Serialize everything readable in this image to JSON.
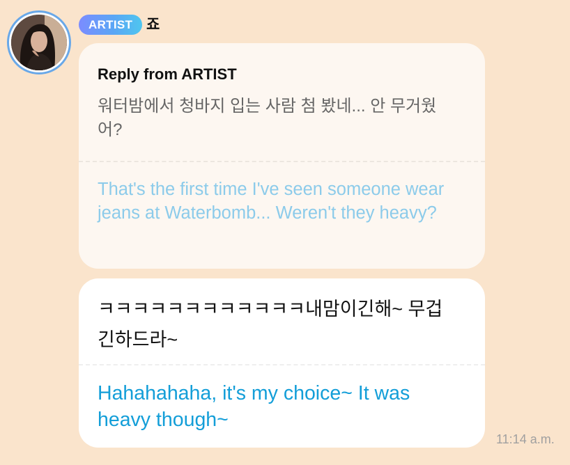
{
  "header": {
    "badge_label": "ARTIST",
    "artist_name": "죠"
  },
  "reply": {
    "title": "Reply from ARTIST",
    "original_text": "워터밤에서 청바지 입는 사람 첨 봤네... 안 무거웠어?",
    "translation_text": "That's the first time I've seen someone wear jeans at Waterbomb... Weren't they heavy?"
  },
  "message": {
    "original_text": "ㅋㅋㅋㅋㅋㅋㅋㅋㅋㅋㅋㅋ내맘이긴해~ 무겁긴하드라~",
    "translation_text": "Hahahahaha, it's my choice~ It was heavy though~",
    "timestamp": "11:14 a.m."
  },
  "colors": {
    "background": "#fae4cc",
    "badge_gradient_start": "#7b8cff",
    "badge_gradient_end": "#4fc6ef",
    "avatar_ring": "#69a8e8",
    "reply_translation": "#8ccbea",
    "message_translation": "#139ed8"
  }
}
